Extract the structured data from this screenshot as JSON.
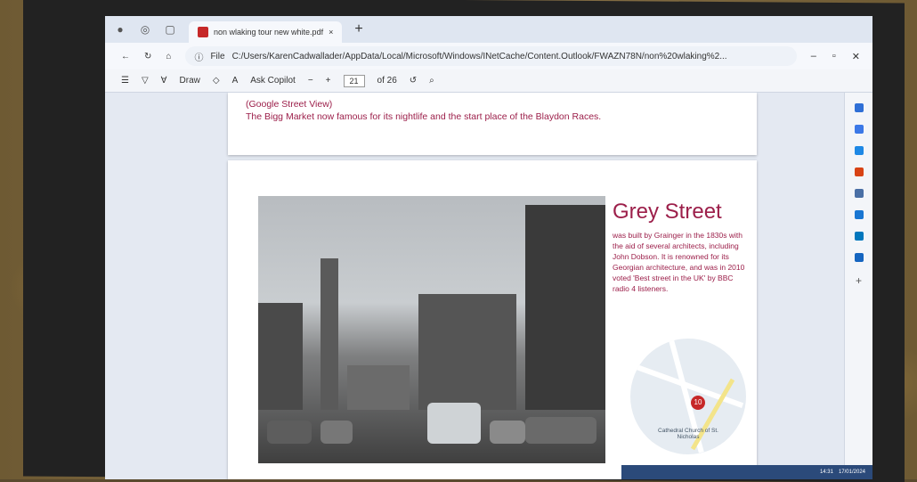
{
  "browser": {
    "tab_title": "non wlaking tour new white.pdf",
    "close_tab": "×",
    "new_tab": "+",
    "address_label": "File",
    "address": "C:/Users/KarenCadwallader/AppData/Local/Microsoft/Windows/INetCache/Content.Outlook/FWAZN78N/non%20wlaking%2..."
  },
  "pdf_toolbar": {
    "draw_label": "Draw",
    "ask_copilot": "Ask Copilot",
    "zoom_out": "−",
    "zoom_in": "+",
    "page_current": "21",
    "page_total": "of 26"
  },
  "page_prev": {
    "line1": "(Google Street View)",
    "line2": "The Bigg Market now famous for its nightlife and the start place of the Blaydon Races."
  },
  "page_main": {
    "title": "Grey Street",
    "description": "was built by Grainger in the 1830s with the aid of several architects, including John Dobson.  It is renowned for its Georgian architecture, and was in 2010 voted 'Best street in the UK' by BBC radio 4 listeners.",
    "map_marker": "10",
    "map_label": "Cathedral Church of St. Nicholas"
  },
  "taskbar": {
    "time": "14:31",
    "date": "17/01/2024"
  },
  "colors": {
    "accent": "#9c1f4a"
  }
}
